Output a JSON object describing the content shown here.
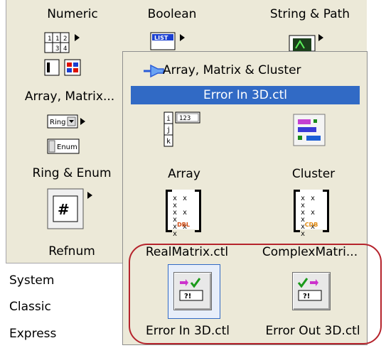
{
  "back_palette": {
    "items": [
      {
        "label": "Numeric"
      },
      {
        "label": "Boolean"
      },
      {
        "label": "String & Path"
      },
      {
        "label": "Array, Matrix..."
      },
      {
        "label": "Ring & Enum"
      },
      {
        "label": "Refnum"
      }
    ],
    "icon_text": {
      "numeric_cells": [
        "1",
        "1",
        "2",
        "3",
        "4"
      ],
      "boolean_list": "LIST",
      "string_path_text": "a",
      "ring_text": "Ring",
      "enum_text": "Enum",
      "refnum_symbol": "#"
    }
  },
  "side_menu": {
    "items": [
      "System",
      "Classic",
      "Express"
    ]
  },
  "sub_palette": {
    "title": "Array, Matrix & Cluster",
    "highlight": "Error In 3D.ctl",
    "items": [
      {
        "label": "Array"
      },
      {
        "label": "Cluster"
      },
      {
        "label": "RealMatrix.ctl"
      },
      {
        "label": "ComplexMatri..."
      },
      {
        "label": "Error In 3D.ctl"
      },
      {
        "label": "Error Out 3D.ctl"
      }
    ],
    "icon_text": {
      "array_index": [
        "i",
        "j",
        "k"
      ],
      "array_value": "123",
      "real_matrix_tag": "DBL",
      "complex_matrix_tag": "CDB",
      "matrix_cells": "x x x",
      "error_symbol": "?!"
    }
  },
  "colors": {
    "selection": "#316ac5",
    "annotation": "#b5232c",
    "palette_bg": "#ece9d8"
  }
}
